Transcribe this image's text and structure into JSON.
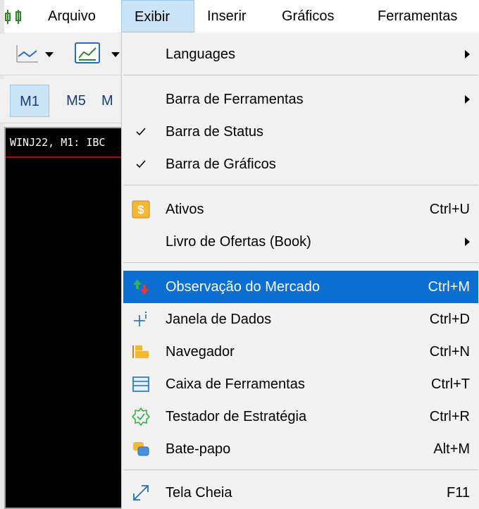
{
  "menubar": {
    "items": [
      {
        "label": "Arquivo"
      },
      {
        "label": "Exibir"
      },
      {
        "label": "Inserir"
      },
      {
        "label": "Gráficos"
      },
      {
        "label": "Ferramentas"
      }
    ]
  },
  "toolbar": {
    "timeframes": [
      {
        "label": "M1"
      },
      {
        "label": "M5"
      },
      {
        "label": "M"
      }
    ]
  },
  "chart": {
    "header": "WINJ22, M1:  IBC"
  },
  "dropdown": {
    "items": [
      {
        "label": "Languages",
        "shortcut": "",
        "submenu": true
      },
      {
        "label": "Barra de Ferramentas",
        "shortcut": "",
        "submenu": true
      },
      {
        "label": "Barra de Status",
        "shortcut": "",
        "checked": true
      },
      {
        "label": "Barra de Gráficos",
        "shortcut": "",
        "checked": true
      },
      {
        "label": "Ativos",
        "shortcut": "Ctrl+U",
        "icon": "dollar-icon"
      },
      {
        "label": "Livro de Ofertas (Book)",
        "shortcut": "",
        "submenu": true
      },
      {
        "label": "Observação do Mercado",
        "shortcut": "Ctrl+M",
        "icon": "market-watch-icon",
        "highlighted": true
      },
      {
        "label": "Janela de Dados",
        "shortcut": "Ctrl+D",
        "icon": "crosshair-icon"
      },
      {
        "label": "Navegador",
        "shortcut": "Ctrl+N",
        "icon": "folder-icon"
      },
      {
        "label": "Caixa de Ferramentas",
        "shortcut": "Ctrl+T",
        "icon": "toolbox-icon"
      },
      {
        "label": "Testador de Estratégia",
        "shortcut": "Ctrl+R",
        "icon": "gear-icon"
      },
      {
        "label": "Bate-papo",
        "shortcut": "Alt+M",
        "icon": "chat-icon"
      },
      {
        "label": "Tela Cheia",
        "shortcut": "F11",
        "icon": "fullscreen-icon"
      }
    ]
  },
  "colors": {
    "highlight": "#0b6ed1",
    "menu_active": "#cce4f7"
  }
}
